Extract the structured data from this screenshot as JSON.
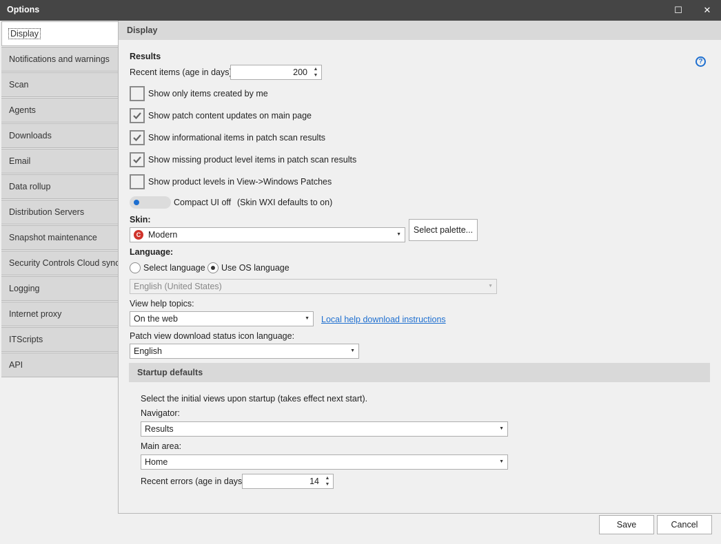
{
  "window": {
    "title": "Options",
    "maximize_glyph": "☐",
    "close_glyph": "✕"
  },
  "sidebar": {
    "items": [
      {
        "label": "Display"
      },
      {
        "label": "Notifications and warnings"
      },
      {
        "label": "Scan"
      },
      {
        "label": "Agents"
      },
      {
        "label": "Downloads"
      },
      {
        "label": "Email"
      },
      {
        "label": "Data rollup"
      },
      {
        "label": "Distribution Servers"
      },
      {
        "label": "Snapshot maintenance"
      },
      {
        "label": "Security Controls Cloud sync"
      },
      {
        "label": "Logging"
      },
      {
        "label": "Internet proxy"
      },
      {
        "label": "ITScripts"
      },
      {
        "label": "API"
      }
    ],
    "active_index": 0
  },
  "display": {
    "header": "Display",
    "results": {
      "title": "Results",
      "recent_items_label": "Recent items (age in days):",
      "recent_items_value": "200",
      "checkboxes": [
        {
          "label": "Show only items created by me",
          "checked": false
        },
        {
          "label": "Show patch content updates on main page",
          "checked": true
        },
        {
          "label": "Show informational items in patch scan results",
          "checked": true
        },
        {
          "label": "Show missing product level items in patch scan results",
          "checked": true
        },
        {
          "label": "Show product levels in View->Windows Patches",
          "checked": false
        }
      ],
      "compact_ui_label": "Compact UI off",
      "compact_ui_note": "(Skin WXI defaults to on)",
      "compact_ui_on": false
    },
    "skin": {
      "label": "Skin:",
      "value": "Modern",
      "icon": "skin-logo-icon",
      "icon_glyph": "C",
      "palette_button": "Select palette..."
    },
    "language": {
      "label": "Language:",
      "option_select": "Select language",
      "option_os": "Use OS language",
      "selected": "os",
      "value": "English (United States)"
    },
    "help_topics": {
      "label": "View help topics:",
      "value": "On the web",
      "link": "Local help download instructions"
    },
    "icon_language": {
      "label": "Patch view download status icon language:",
      "value": "English"
    },
    "help_icon_glyph": "?"
  },
  "startup": {
    "header": "Startup defaults",
    "description": "Select the initial views upon startup (takes effect next start).",
    "navigator_label": "Navigator:",
    "navigator_value": "Results",
    "main_area_label": "Main area:",
    "main_area_value": "Home",
    "recent_errors_label": "Recent errors (age in days):",
    "recent_errors_value": "14"
  },
  "footer": {
    "save": "Save",
    "cancel": "Cancel"
  },
  "colors": {
    "accent": "#1e6fd0",
    "titlebar": "#454545",
    "skin_icon": "#d0342c"
  }
}
